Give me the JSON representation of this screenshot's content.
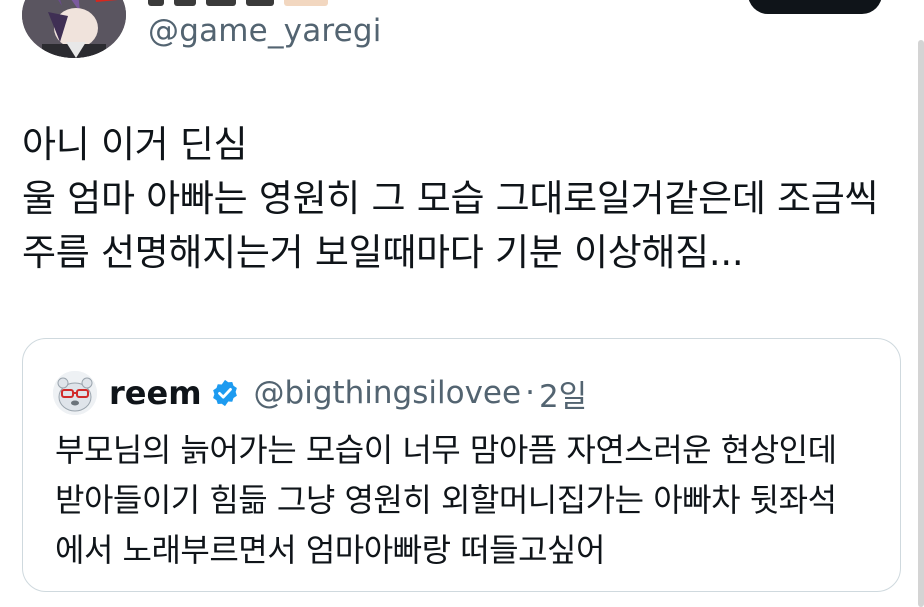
{
  "tweet": {
    "author": {
      "handle": "@game_yaregi"
    },
    "text_lines": [
      "아니 이거 딘심",
      "울 엄마 아빠는 영원히 그 모습 그대로일거같은데 조금씩",
      "주름 선명해지는거 보일때마다 기분 이상해짐..."
    ]
  },
  "quote": {
    "author": {
      "name": "reem",
      "handle": "@bigthingsilovee",
      "separator": "·",
      "time": "2일"
    },
    "text_lines": [
      "부모님의 늙어가는 모습이 너무 맘아픔 자연스러운 현상인데",
      "받아들이기 힘듦 그냥 영원히 외할머니집가는 아빠차 뒷좌석",
      "에서 노래부르면서 엄마아빠랑 떠들고싶어"
    ]
  },
  "colors": {
    "text": "#0f1419",
    "secondary": "#536471",
    "verified": "#1d9bf0",
    "border": "#cfd9de",
    "button": "#0f1419"
  },
  "icons": {
    "verified": "verified-badge-icon",
    "author_avatar": "author-avatar",
    "quote_avatar": "quote-avatar"
  }
}
